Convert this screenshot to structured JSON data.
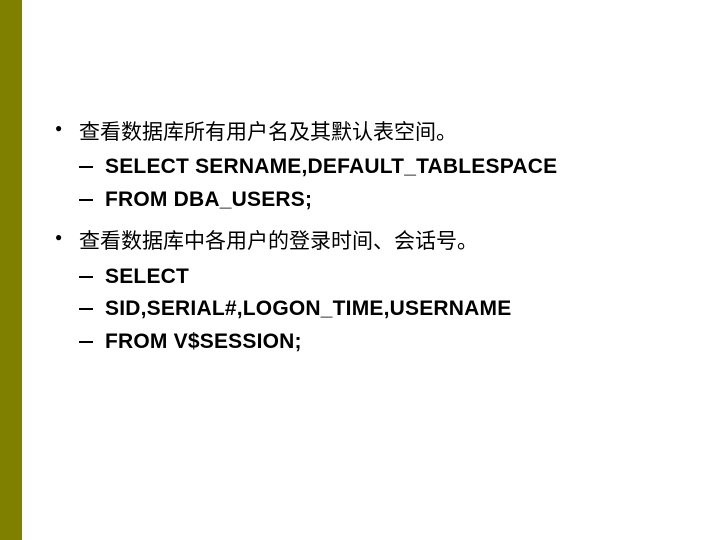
{
  "slide": {
    "groups": [
      {
        "title": "查看数据库所有用户名及其默认表空间。",
        "lines": [
          "SELECT SERNAME,DEFAULT_TABLESPACE",
          "FROM DBA_USERS;"
        ]
      },
      {
        "title": "查看数据库中各用户的登录时间、会话号。",
        "lines": [
          "SELECT",
          "SID,SERIAL#,LOGON_TIME,USERNAME",
          "FROM V$SESSION;"
        ]
      }
    ]
  }
}
